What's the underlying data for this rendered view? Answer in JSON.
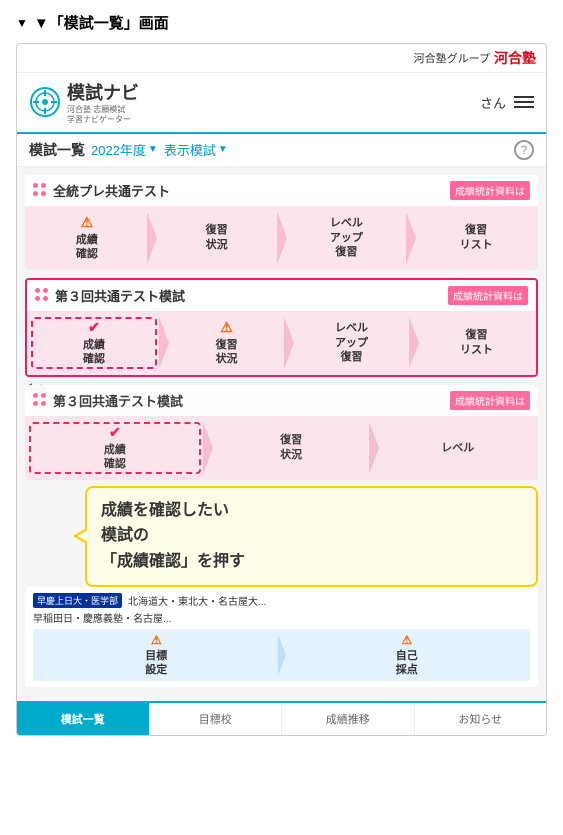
{
  "page": {
    "title_prefix": "▼「模試一覧」画面"
  },
  "topbar": {
    "group_label": "河合塾グループ",
    "brand": "河合塾"
  },
  "header": {
    "logo_text": "模試ナビ",
    "logo_sub_line1": "河合塾 志願模試",
    "logo_sub_line2": "学習ナビゲーター",
    "san_label": "さん",
    "menu_label": "メニュー"
  },
  "subheader": {
    "title": "模試一覧",
    "year": "2022年度",
    "display": "表示模試",
    "help": "?"
  },
  "exam1": {
    "title": "全統プレ共通テスト",
    "badge": "成績統計資料は",
    "btn1_label": "成績\n確認",
    "btn2_label": "復習\n状況",
    "btn3_label": "レベル\nアップ\n復習",
    "btn4_label": "復習\nリスト"
  },
  "exam2": {
    "title": "第３回共通テスト模試",
    "badge": "成績統計資料は",
    "btn1_label": "成績\n確認",
    "btn2_label": "復習\n状況",
    "btn3_label": "レベル\nアップ\n復習",
    "btn4_label": "復習\nリスト",
    "highlighted": true
  },
  "exam3": {
    "title": "第３回共通テスト模試",
    "badge": "成績統計資料は",
    "btn1_label": "成績\n確認",
    "btn2_label": "復習\n状況",
    "btn3_label": "レベル"
  },
  "univ": {
    "badge_text": "早慶上日大・医学部",
    "detail": "北海道大・東北大・名古屋大...",
    "detail2": "早稲田日・慶應義塾・名古屋..."
  },
  "goal": {
    "btn1": "目標\n設定",
    "btn2": "自己\n採点"
  },
  "tooltip": {
    "line1": "成績を確認したい",
    "line2": "模試の",
    "line3": "「成績確認」を押す"
  },
  "bottomnav": {
    "items": [
      {
        "label": "模試一覧",
        "active": true
      },
      {
        "label": "目標校",
        "active": false
      },
      {
        "label": "成績推移",
        "active": false
      },
      {
        "label": "お知らせ",
        "active": false
      }
    ]
  }
}
